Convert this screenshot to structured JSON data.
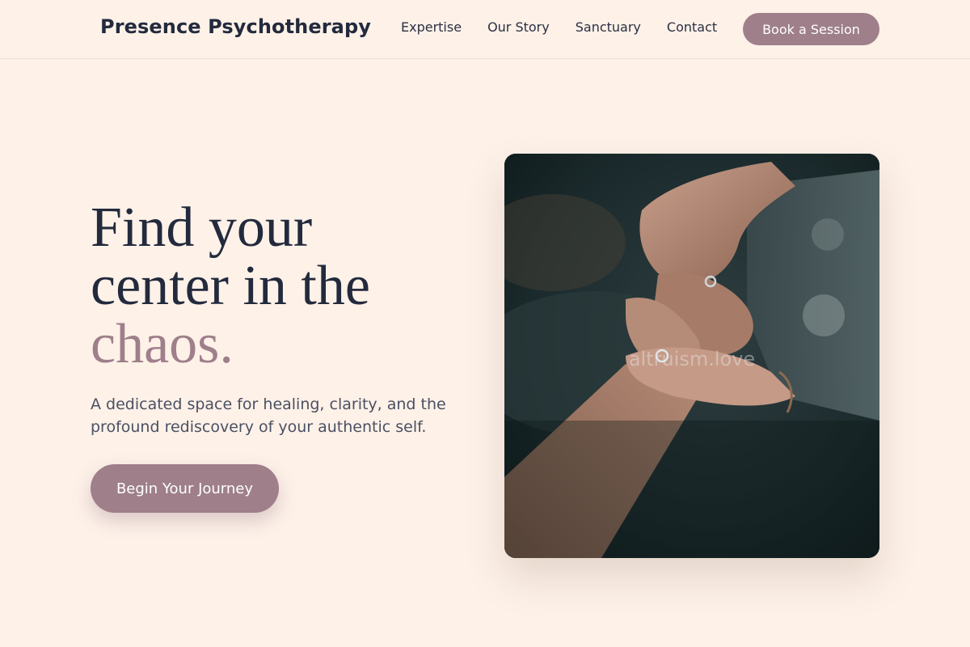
{
  "header": {
    "brand": "Presence Psychotherapy",
    "nav": [
      {
        "label": "Expertise"
      },
      {
        "label": "Our Story"
      },
      {
        "label": "Sanctuary"
      },
      {
        "label": "Contact"
      }
    ],
    "book_label": "Book a Session"
  },
  "hero": {
    "headline_line1": "Find your",
    "headline_line2": "center in the",
    "headline_accent": "chaos.",
    "subtext": "A dedicated space for healing, clarity, and the profound rediscovery of your authentic self.",
    "cta_label": "Begin Your Journey",
    "image": {
      "description_icon": "hands-holding-photo",
      "watermark": "altruism.love"
    }
  },
  "colors": {
    "background": "#fdf1e8",
    "accent": "#9e7f8a",
    "text_dark": "#232a3d",
    "text_muted": "#4b5063"
  }
}
